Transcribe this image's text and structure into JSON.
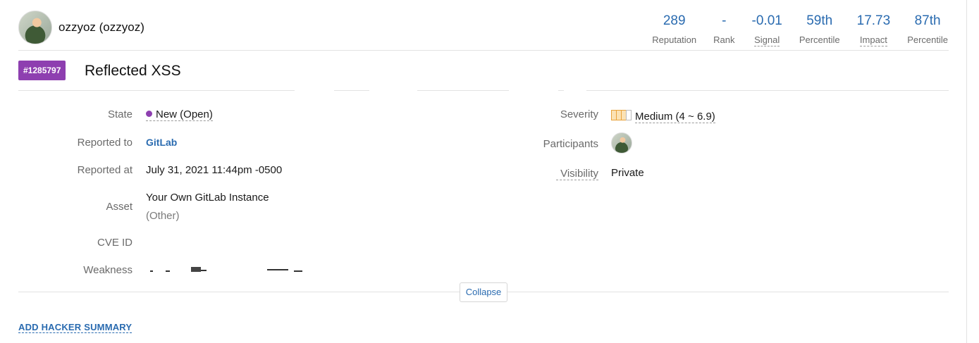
{
  "user": {
    "display_name": "ozzyoz (ozzyoz)"
  },
  "stats": [
    {
      "value": "289",
      "label": "Reputation",
      "dotted": false
    },
    {
      "value": "-",
      "label": "Rank",
      "dotted": false
    },
    {
      "value": "-0.01",
      "label": "Signal",
      "dotted": true
    },
    {
      "value": "59th",
      "label": "Percentile",
      "dotted": false
    },
    {
      "value": "17.73",
      "label": "Impact",
      "dotted": true
    },
    {
      "value": "87th",
      "label": "Percentile",
      "dotted": false
    }
  ],
  "report": {
    "id": "#1285797",
    "title": "Reflected XSS"
  },
  "details": {
    "state_label": "State",
    "state_value": "New (Open)",
    "reported_to_label": "Reported to",
    "reported_to_value": "GitLab",
    "reported_at_label": "Reported at",
    "reported_at_value": "July 31, 2021 11:44pm -0500",
    "asset_label": "Asset",
    "asset_value": "Your Own GitLab Instance",
    "asset_type": "(Other)",
    "cve_label": "CVE ID",
    "cve_value": "",
    "weakness_label": "Weakness",
    "severity_label": "Severity",
    "severity_value": "Medium (4 ~ 6.9)",
    "participants_label": "Participants",
    "visibility_label": "Visibility",
    "visibility_value": "Private"
  },
  "actions": {
    "collapse_label": "Collapse",
    "add_summary_label": "ADD HACKER SUMMARY"
  },
  "colors": {
    "accent": "#2a6bb0",
    "report_badge": "#8e3fb0",
    "severity_medium": "#e8a33c"
  }
}
